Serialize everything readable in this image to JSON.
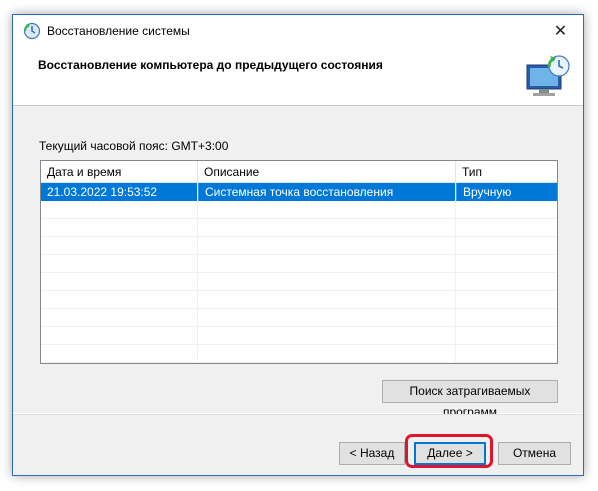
{
  "window": {
    "title": "Восстановление системы",
    "close_glyph": "✕"
  },
  "header": {
    "title": "Восстановление компьютера до предыдущего состояния",
    "icon": "system-restore-icon"
  },
  "timezone_label": "Текущий часовой пояс: GMT+3:00",
  "list": {
    "columns": [
      "Дата и время",
      "Описание",
      "Тип"
    ],
    "sort_column": "Дата и время",
    "rows": [
      {
        "date": "21.03.2022 19:53:52",
        "description": "Системная точка восстановления",
        "type": "Вручную",
        "selected": true
      }
    ]
  },
  "buttons": {
    "scan": "Поиск затрагиваемых программ",
    "back": "< Назад",
    "next": "Далее >",
    "cancel": "Отмена"
  },
  "colors": {
    "selection": "#0078d7",
    "highlight": "#e0142a",
    "window_border": "#2b6bbf"
  }
}
